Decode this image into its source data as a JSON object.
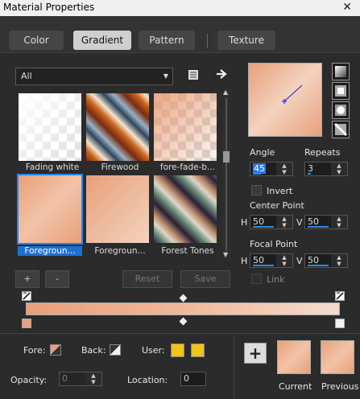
{
  "window": {
    "title": "Material Properties",
    "close_glyph": "✕"
  },
  "tabs": [
    {
      "label": "Color",
      "active": false
    },
    {
      "label": "Gradient",
      "active": true
    },
    {
      "label": "Pattern",
      "active": false
    },
    {
      "label": "Texture",
      "active": false
    }
  ],
  "library": {
    "category": "All",
    "items": [
      {
        "label": "Fading white",
        "selected": false
      },
      {
        "label": "Firewood",
        "selected": false
      },
      {
        "label": "fore-fade-b...",
        "selected": false
      },
      {
        "label": "Foregroun...",
        "selected": true
      },
      {
        "label": "Foregroun...",
        "selected": false
      },
      {
        "label": "Forest Tones",
        "selected": false
      }
    ]
  },
  "buttons": {
    "add": "+",
    "remove": "-",
    "reset": "Reset",
    "save": "Save"
  },
  "settings": {
    "angle_label": "Angle",
    "angle_value": "45",
    "repeats_label": "Repeats",
    "repeats_value": "3",
    "invert_label": "Invert",
    "invert_checked": false,
    "center_label": "Center Point",
    "center_h_label": "H",
    "center_h": "50",
    "center_v_label": "V",
    "center_v": "50",
    "focal_label": "Focal Point",
    "focal_h_label": "H",
    "focal_h": "50",
    "focal_v_label": "V",
    "focal_v": "50",
    "link_label": "Link",
    "link_checked": false
  },
  "ramp": {
    "start_color": "#e8a07a",
    "mid_color": "#f0b89a",
    "end_color": "#f3dccf"
  },
  "bottom": {
    "fore_label": "Fore:",
    "back_label": "Back:",
    "user_label": "User:",
    "user_colors": [
      "#f0c419",
      "#f0c419"
    ],
    "opacity_label": "Opacity:",
    "opacity_value": "0",
    "location_label": "Location:",
    "location_value": "0",
    "current_label": "Current",
    "previous_label": "Previous",
    "plus": "+"
  },
  "colors": {
    "accent": "#1f6fd1",
    "peach": "#e8a07a",
    "peach_light": "#f3dccf"
  },
  "icons": [
    "close-icon",
    "book-icon",
    "arrow-right-icon",
    "chevron-down-icon",
    "chevron-up-icon",
    "gradient-style-linear-icon",
    "gradient-style-rectangular-icon",
    "gradient-style-sunburst-icon",
    "gradient-style-radial-icon",
    "fore-swatch-icon",
    "back-swatch-icon"
  ]
}
